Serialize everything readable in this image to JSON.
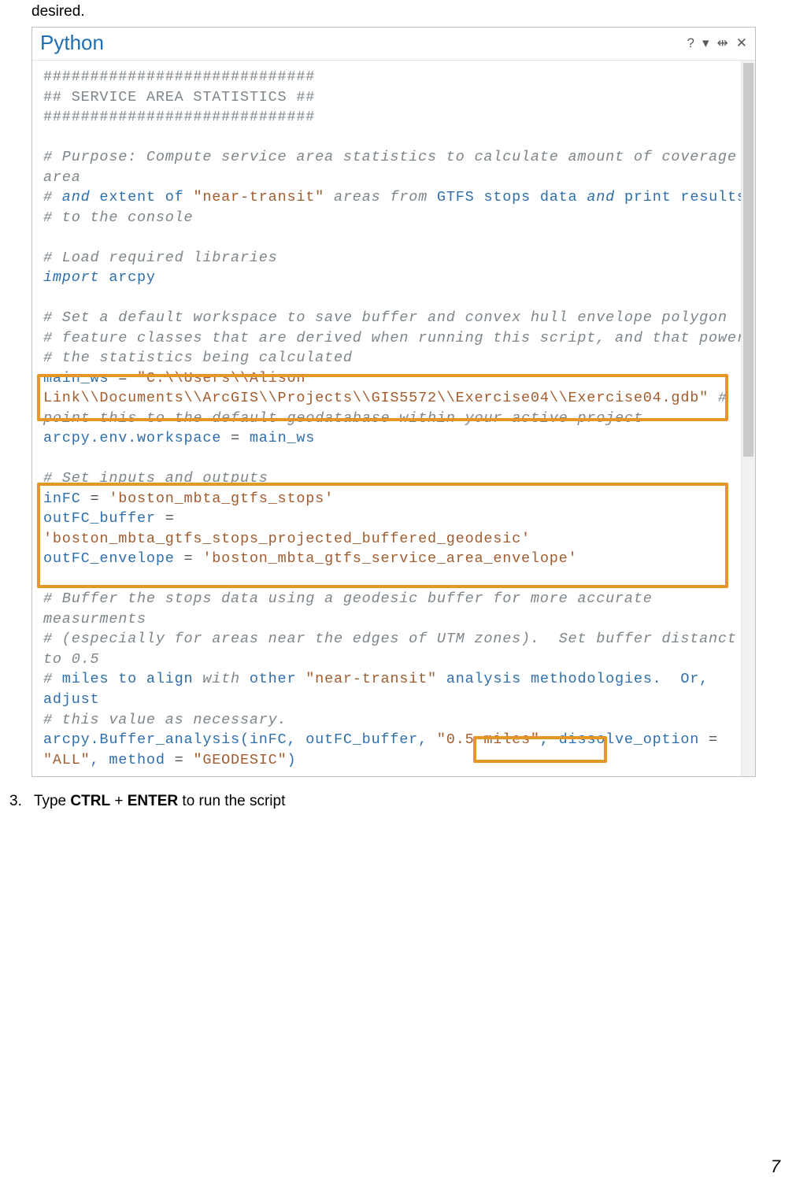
{
  "fragmentTop": "desired.",
  "panel": {
    "title": "Python"
  },
  "code": {
    "l1": "#############################",
    "l2": "## SERVICE AREA STATISTICS ##",
    "l3": "#############################",
    "c1": "# Purpose: Compute service area statistics to calculate amount of coverage area",
    "c2a": "#",
    "c2_and": " and ",
    "c2b": "extent of ",
    "c2_str": "\"near-transit\"",
    "c2c": " areas ",
    "c2_from": "from",
    "c2d": " GTFS stops data ",
    "c2_and2": "and",
    "c2_print": "print",
    "c2e": " results",
    "c3": "# to the console",
    "c4": "# Load required libraries",
    "imp": "import",
    "mod": " arcpy",
    "c5": "# Set a default workspace to save buffer and convex hull envelope polygon",
    "c6": "# feature classes that are derived when running this script, and that power",
    "c7": "# the statistics being calculated",
    "v1": "main_ws",
    "eq": " = ",
    "s1": "\"C:\\\\Users\\\\Alison Link\\\\Documents\\\\ArcGIS\\\\Projects\\\\GIS5572\\\\Exercise04\\\\Exercise04.gdb\"",
    "c8": " # point this to the default geodatabase within your active project",
    "v2": "arcpy.env.workspace",
    "v3": "main_ws",
    "c9": "# Set inputs and outputs",
    "v4": "inFC",
    "s2": "'boston_mbta_gtfs_stops'",
    "v5": "outFC_buffer",
    "s3": "'boston_mbta_gtfs_stops_projected_buffered_geodesic'",
    "v6": "outFC_envelope",
    "s4": "'boston_mbta_gtfs_service_area_envelope'",
    "c10": "# Buffer the stops data using a geodesic buffer for more accurate measurments",
    "c11": "# (especially for areas near the edges of UTM zones).  Set buffer distanct to 0.5",
    "c12a": "#",
    "c12_miles": " miles to align ",
    "c12_with": "with",
    "c12b": " other ",
    "c12_str": "\"near-transit\"",
    "c12c": " analysis methodologies.  Or, adjust",
    "c13": "# this value as necessary.",
    "call": "arcpy.Buffer_analysis(inFC, outFC_buffer, ",
    "s5": "\"0.5 miles\"",
    "callb": ", dissolve_option",
    "s6": "\"ALL\"",
    "callc": ", method",
    "s7": "\"GEODESIC\"",
    "calld": ")"
  },
  "step": {
    "num": "3.",
    "textA": "Type ",
    "ctrl": "CTRL",
    "plus": " + ",
    "enter": "ENTER",
    "textB": " to run the script"
  },
  "pageNumber": "7"
}
